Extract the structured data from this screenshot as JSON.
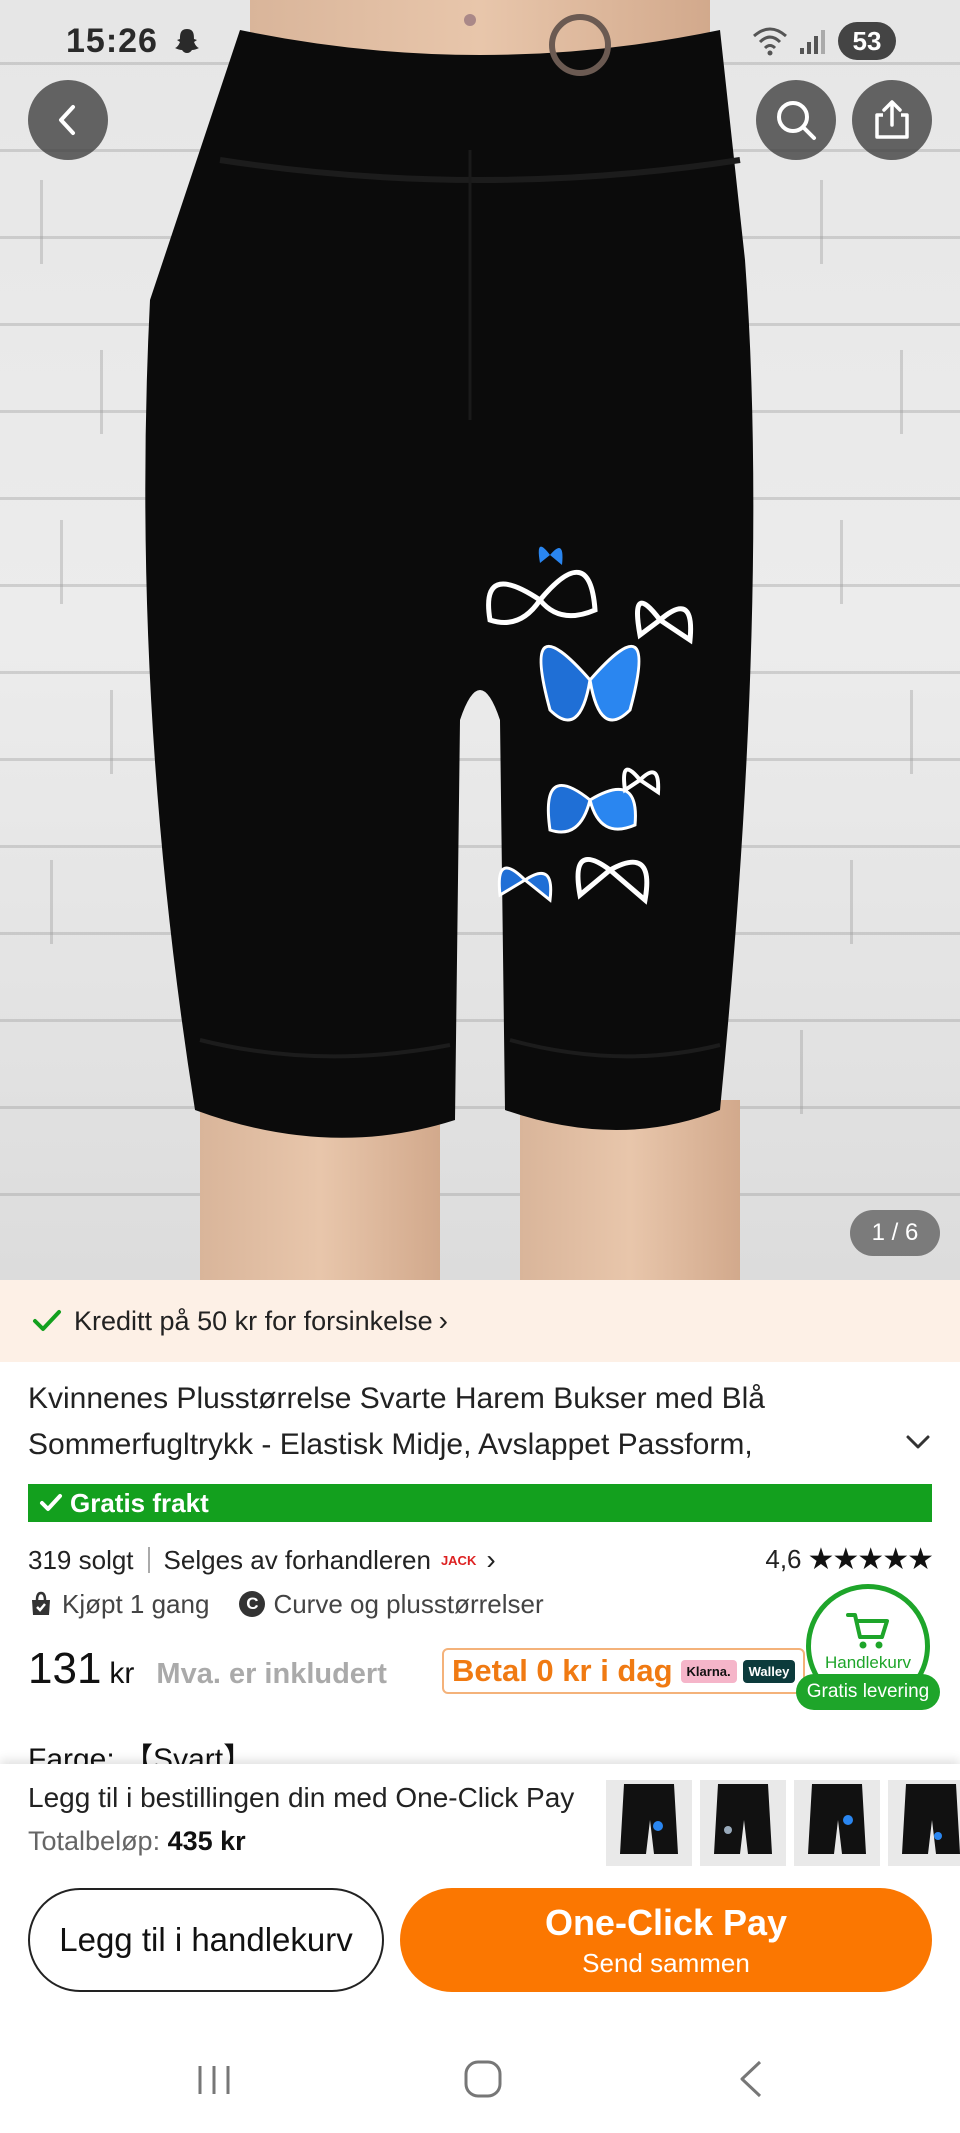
{
  "status_bar": {
    "time": "15:26",
    "battery": "53",
    "snap_icon": "snapchat-ghost-icon",
    "wifi_icon": "wifi-icon",
    "signal_icon": "signal-icon"
  },
  "header": {
    "back_icon": "chevron-left-icon",
    "search_icon": "search-icon",
    "share_icon": "share-icon",
    "image_counter": "1 / 6"
  },
  "credit_banner": {
    "text": "Kreditt på 50 kr for forsinkelse",
    "chevron": "›",
    "icon": "check-icon",
    "color": "#13a01e"
  },
  "product": {
    "title": "Kvinnenes Plusstørrelse Svarte Harem Bukser med Blå Sommerfugltrykk - Elastisk Midje, Avslappet Passform,",
    "free_shipping": "Gratis frakt",
    "sold": "319 solgt",
    "seller": "Selges av forhandleren",
    "seller_logo": "JACK",
    "rating": "4,6",
    "stars": "★★★★★",
    "bought": "Kjøpt 1 gang",
    "curve_badge": "C",
    "curve_text": "Curve og plusstørrelser",
    "price": "131",
    "currency": "kr",
    "vat": "Mva. er inkludert",
    "pay_later": "Betal 0 kr i dag",
    "klarna": "Klarna.",
    "walley": "Walley",
    "color_label": "Farge:",
    "color_value": "【Svart】"
  },
  "cart_fab": {
    "label": "Handlekurv",
    "badge": "Gratis levering",
    "icon": "shopping-cart-icon",
    "color": "#1ea52a"
  },
  "one_click": {
    "title": "Legg til i bestillingen din med One-Click Pay",
    "total_label": "Totalbeløp:",
    "total_value": "435 kr"
  },
  "actions": {
    "add_to_cart": "Legg til i handlekurv",
    "one_click_pay": "One-Click Pay",
    "send_together": "Send sammen",
    "accent": "#fb7701"
  }
}
